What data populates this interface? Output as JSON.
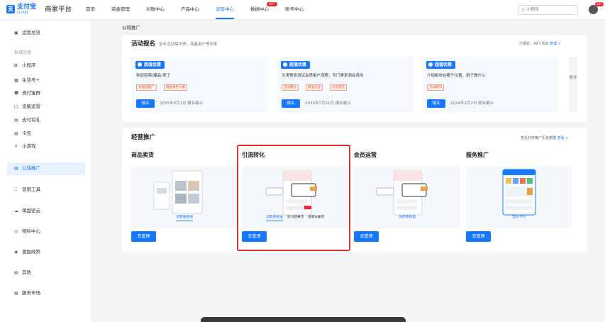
{
  "brand": {
    "logo_mark": "支",
    "logo_name": "支付宝",
    "logo_sub": "ALIPAY",
    "platform": "商家平台"
  },
  "nav": {
    "items": [
      "首页",
      "资金管理",
      "对账中心",
      "产品中心",
      "运营中心",
      "数据中心",
      "账号中心"
    ],
    "active_index": 4,
    "hot_badge": "HOT"
  },
  "search": {
    "placeholder": "小程序"
  },
  "avatar_badge": "167",
  "sidebar": {
    "overview": "运营总览",
    "group_private": "私域运营",
    "items": [
      "小程序",
      "生活号+",
      "支付宝群",
      "设备运营",
      "支付有礼",
      "卡包",
      "小游戏"
    ],
    "public": "公域推广",
    "marketing": "营销工具",
    "cloud": "棋盘密云",
    "material": "物料中心",
    "incentive": "激励政策",
    "other": "其他",
    "market": "服务市场"
  },
  "breadcrumb": "公域推广",
  "activity": {
    "title": "活动报名",
    "subtitle": "全年活动搞不停，海量用户等你来",
    "registered": "已报名：49个活动",
    "manage_link": "管理 >",
    "more": "更多",
    "cards": [
      {
        "tag": "超值优惠",
        "desc": "秋促招商(爆品)来了",
        "chips": [
          "多维度推广",
          "精准事件人群"
        ],
        "button": "报名",
        "deadline": "2025年9月1日 报名截止"
      },
      {
        "tag": "超值优惠",
        "desc": "文涛预发测试会员租户流程，专门拿来测会员的",
        "chips": [
          "活动曝光",
          "精准投放",
          "引流到店"
        ],
        "button": "报名",
        "deadline": "2030年7月31日 报名截止"
      },
      {
        "tag": "超值优惠",
        "desc": "介绍板块在哪个位置，用于做什么",
        "chips": [
          "活动曝光"
        ],
        "button": "报名",
        "deadline": "2024年2月2日 报名截止"
      }
    ]
  },
  "business": {
    "title": "经营推广",
    "history": "查看日常推广历史数据",
    "history_link": "查看 >",
    "features": [
      {
        "title": "商品卖货",
        "tabs": [
          "消费圈频道"
        ],
        "active_tab": 0,
        "button": "去管理"
      },
      {
        "title": "引流转化",
        "tabs": [
          "消费券频道",
          "支付结果页",
          "搜索&推荐"
        ],
        "active_tab": 0,
        "button": "去管理"
      },
      {
        "title": "会员运营",
        "tabs": [
          "消费券频道"
        ],
        "active_tab": 0,
        "button": "去管理"
      },
      {
        "title": "服务推广",
        "tabs": [
          "首页卡片"
        ],
        "active_tab": 0,
        "button": "去管理"
      }
    ]
  },
  "colors": {
    "accent": "#1677ff",
    "highlight": "#d7302a",
    "chip": "#e8562c"
  },
  "icons": {
    "search": "search-icon",
    "avatar": "user-avatar",
    "tag": "coupon-icon"
  }
}
